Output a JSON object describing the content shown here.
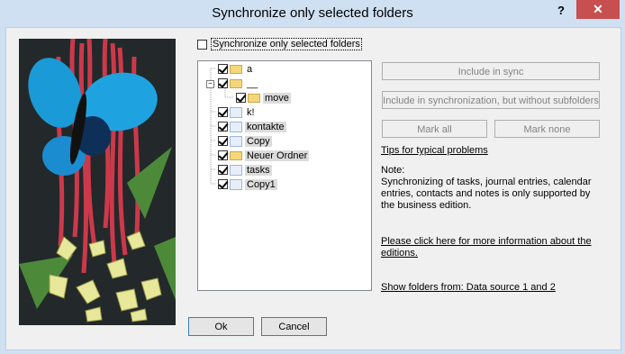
{
  "window": {
    "title": "Synchronize only selected folders",
    "help_glyph": "?",
    "close_glyph": "✕"
  },
  "sync_option": {
    "label": "Synchronize only selected folders",
    "checked": false
  },
  "tree": {
    "items": [
      {
        "label": "a",
        "checked": true,
        "icon": "folder-icon"
      },
      {
        "label": "__",
        "checked": true,
        "icon": "folder-icon",
        "expanded": true
      },
      {
        "label": "move",
        "checked": true,
        "icon": "folder-icon"
      },
      {
        "label": "k!",
        "checked": true,
        "icon": "contacts-icon"
      },
      {
        "label": "kontakte",
        "checked": true,
        "icon": "contacts-icon"
      },
      {
        "label": "Copy",
        "checked": true,
        "icon": "calendar-icon"
      },
      {
        "label": "Neuer Ordner",
        "checked": true,
        "icon": "folder-icon"
      },
      {
        "label": "tasks",
        "checked": true,
        "icon": "tasks-icon"
      },
      {
        "label": "Copy1",
        "checked": true,
        "icon": "calendar-icon"
      }
    ]
  },
  "buttons": {
    "include": "Include in sync",
    "include_no_sub": "Include in synchronization, but without subfolders",
    "mark_all": "Mark all",
    "mark_none": "Mark none",
    "ok": "Ok",
    "cancel": "Cancel"
  },
  "links": {
    "tips": "Tips for typical problems",
    "editions": "Please click here for more information about the editions.",
    "show_folders": "Show folders from: Data source 1 and 2"
  },
  "note": {
    "heading": "Note:",
    "text": "Synchronizing of tasks, journal entries, calendar entries, contacts and notes is only supported by the business edition."
  },
  "colors": {
    "title_bg": "#cfe0f2",
    "close_red": "#c74f4f",
    "tree_selected": "#dcdcdc"
  }
}
